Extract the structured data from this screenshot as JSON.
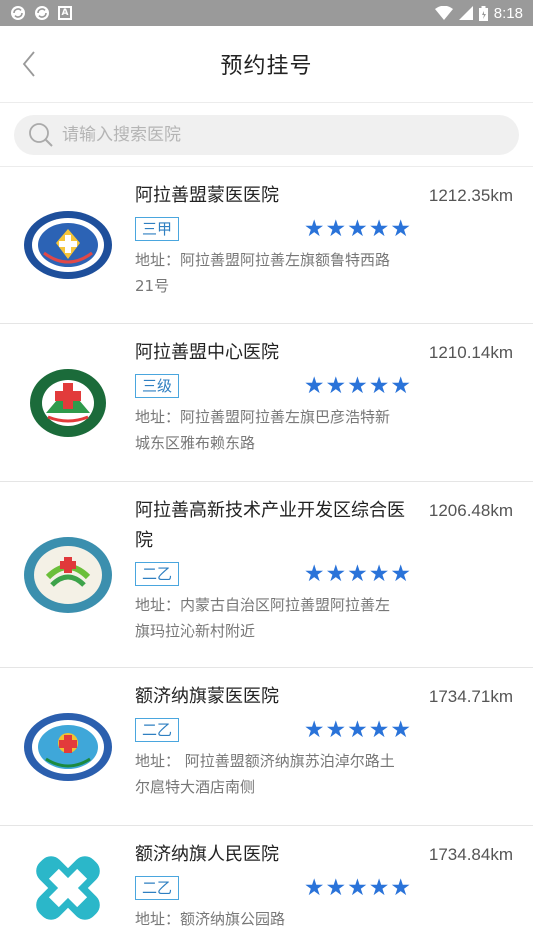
{
  "status_bar": {
    "time": "8:18"
  },
  "header": {
    "title": "预约挂号"
  },
  "search": {
    "placeholder": "请输入搜索医院"
  },
  "hospitals": [
    {
      "name": "阿拉善盟蒙医医院",
      "distance": "1212.35km",
      "grade": "三甲",
      "stars": 5,
      "address": "地址：阿拉善盟阿拉善左旗额鲁特西路21号",
      "logo": "mongolian-medicine-hospital-logo"
    },
    {
      "name": "阿拉善盟中心医院",
      "distance": "1210.14km",
      "grade": "三级",
      "stars": 5,
      "address": "地址：阿拉善盟阿拉善左旗巴彦浩特新城东区雅布赖东路",
      "logo": "central-hospital-logo"
    },
    {
      "name": "阿拉善高新技术产业开发区综合医院",
      "distance": "1206.48km",
      "grade": "二乙",
      "stars": 5,
      "address": "地址：内蒙古自治区阿拉善盟阿拉善左旗玛拉沁新村附近",
      "logo": "hi-tech-zone-hospital-logo"
    },
    {
      "name": "额济纳旗蒙医医院",
      "distance": "1734.71km",
      "grade": "二乙",
      "stars": 5,
      "address": "地址： 阿拉善盟额济纳旗苏泊淖尔路土尔扈特大酒店南侧",
      "logo": "ejina-mongolian-hospital-logo"
    },
    {
      "name": "额济纳旗人民医院",
      "distance": "1734.84km",
      "grade": "二乙",
      "stars": 5,
      "address": "地址：额济纳旗公园路",
      "logo": "ejina-people-hospital-logo"
    }
  ],
  "colors": {
    "accent": "#2a73d9",
    "grade_border": "#4aa6de",
    "status_bar": "#9a9a9a"
  }
}
